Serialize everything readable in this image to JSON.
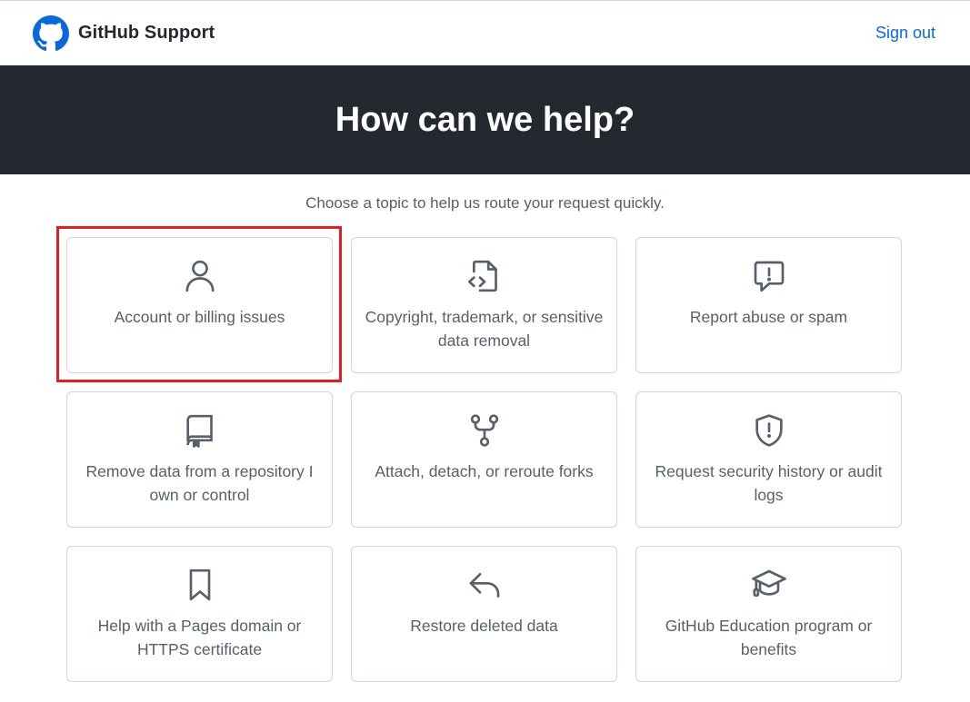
{
  "header": {
    "brand_title": "GitHub Support",
    "sign_out": "Sign out"
  },
  "hero": {
    "title": "How can we help?"
  },
  "subtitle": "Choose a topic to help us route your request quickly.",
  "topics": [
    {
      "label": "Account or billing issues",
      "icon": "person-icon"
    },
    {
      "label": "Copyright, trademark, or sensitive data removal",
      "icon": "file-code-icon"
    },
    {
      "label": "Report abuse or spam",
      "icon": "report-icon"
    },
    {
      "label": "Remove data from a repository I own or control",
      "icon": "repo-icon"
    },
    {
      "label": "Attach, detach, or reroute forks",
      "icon": "repo-forked-icon"
    },
    {
      "label": "Request security history or audit logs",
      "icon": "shield-icon"
    },
    {
      "label": "Help with a Pages domain or HTTPS certificate",
      "icon": "bookmark-icon"
    },
    {
      "label": "Restore deleted data",
      "icon": "reply-icon"
    },
    {
      "label": "GitHub Education program or benefits",
      "icon": "mortar-board-icon"
    }
  ],
  "colors": {
    "hero_background": "#24292f",
    "link": "#0969da",
    "highlight": "#e01e24",
    "card_border": "#d0d7de",
    "muted_text": "#57606a"
  }
}
